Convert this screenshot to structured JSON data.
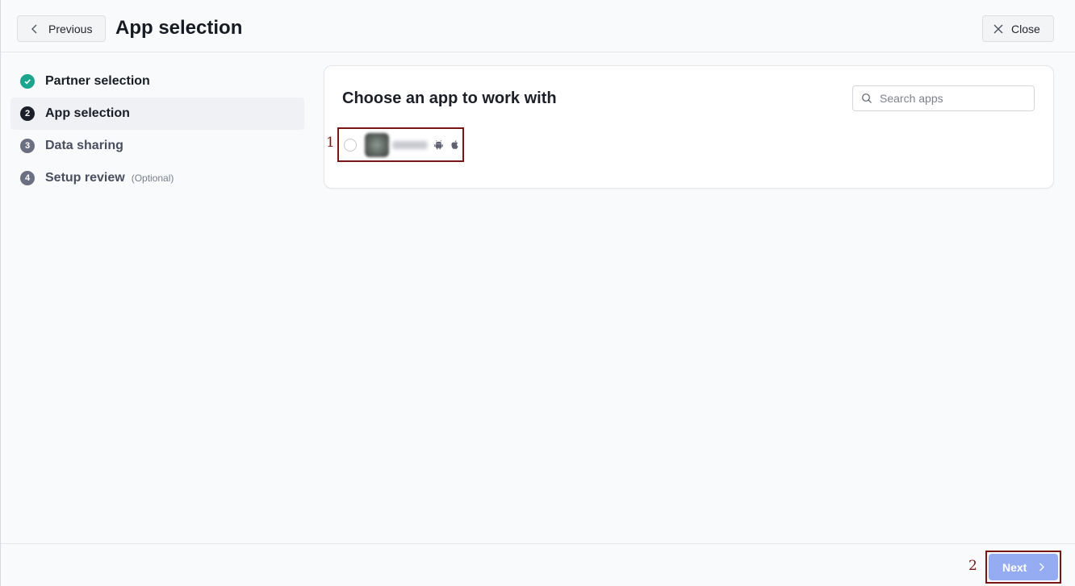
{
  "header": {
    "previous_label": "Previous",
    "title": "App selection",
    "close_label": "Close"
  },
  "steps": [
    {
      "number": "1",
      "label": "Partner selection",
      "status": "done"
    },
    {
      "number": "2",
      "label": "App selection",
      "status": "current"
    },
    {
      "number": "3",
      "label": "Data sharing",
      "status": "pending"
    },
    {
      "number": "4",
      "label": "Setup review",
      "status": "pending",
      "note": "(Optional)"
    }
  ],
  "card": {
    "title": "Choose an app to work with",
    "search_placeholder": "Search apps",
    "search_value": "",
    "apps": [
      {
        "selected": false,
        "platforms": [
          "android-icon",
          "apple-icon"
        ]
      }
    ]
  },
  "annotations": {
    "app_row": "1",
    "next": "2"
  },
  "footer": {
    "next_label": "Next"
  },
  "colors": {
    "done": "#1ba58d",
    "current": "#1c1f29",
    "pending": "#6b6f82",
    "next_button": "#95acf2",
    "annotation": "#7a1515"
  }
}
